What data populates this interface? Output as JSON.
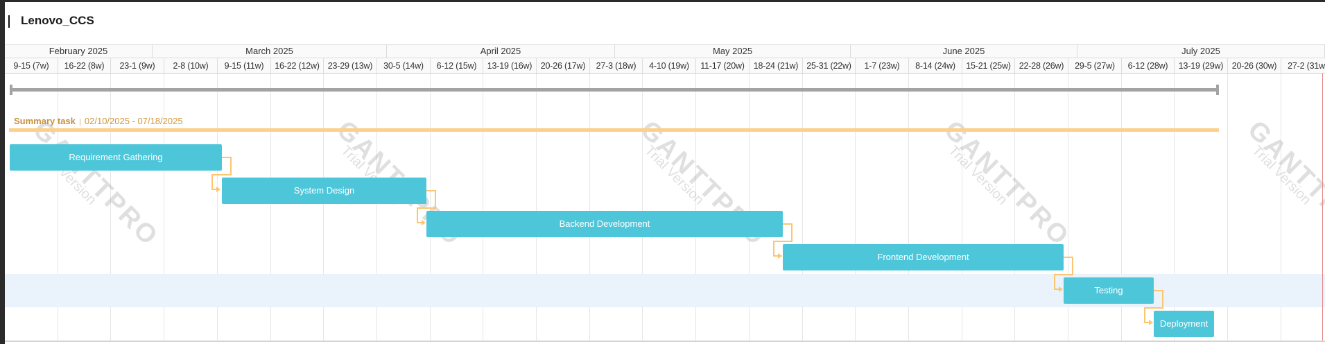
{
  "project": {
    "title": "Lenovo_CCS"
  },
  "timeline": {
    "months": [
      "February 2025",
      "March 2025",
      "April 2025",
      "May 2025",
      "June 2025",
      "July 2025"
    ],
    "weeks": [
      "9-15 (7w)",
      "16-22 (8w)",
      "23-1 (9w)",
      "2-8 (10w)",
      "9-15 (11w)",
      "16-22 (12w)",
      "23-29 (13w)",
      "30-5 (14w)",
      "6-12 (15w)",
      "13-19 (16w)",
      "20-26 (17w)",
      "27-3 (18w)",
      "4-10 (19w)",
      "11-17 (20w)",
      "18-24 (21w)",
      "25-31 (22w)",
      "1-7 (23w)",
      "8-14 (24w)",
      "15-21 (25w)",
      "22-28 (26w)",
      "29-5 (27w)",
      "6-12 (28w)",
      "13-19 (29w)",
      "20-26 (30w)",
      "27-2 (31w)"
    ]
  },
  "summary": {
    "label": "Summary task",
    "dates": "02/10/2025 - 07/18/2025"
  },
  "tasks": [
    {
      "name": "Requirement Gathering"
    },
    {
      "name": "System Design"
    },
    {
      "name": "Backend Development"
    },
    {
      "name": "Frontend Development"
    },
    {
      "name": "Testing"
    },
    {
      "name": "Deployment"
    }
  ],
  "watermark": {
    "brand": "GANTTPRO",
    "sub": "Trial Version"
  },
  "colors": {
    "task": "#4ec6d9",
    "summary": "#fdd08a",
    "summary_text": "#c8903a",
    "dependency": "#fdc56f",
    "highlight_row": "#eaf3fc",
    "project_bar": "#a3a3a3"
  }
}
